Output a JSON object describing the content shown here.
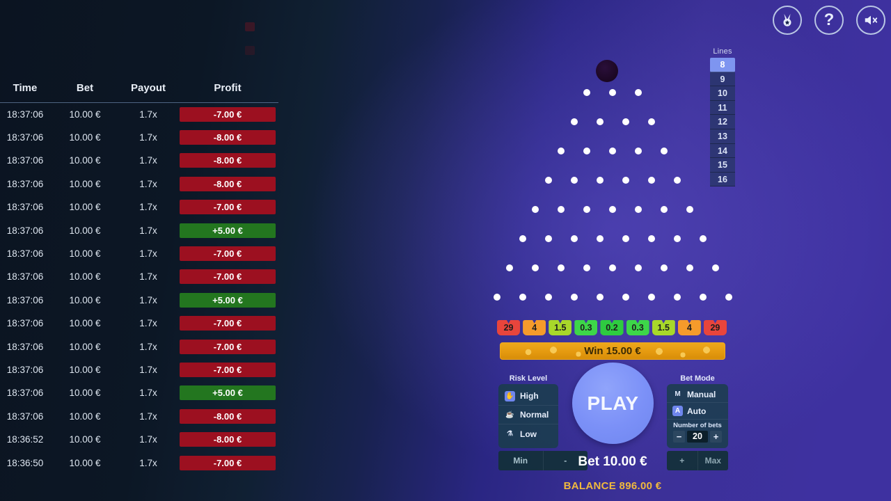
{
  "history": {
    "columns": [
      "Time",
      "Bet",
      "Payout",
      "Profit"
    ],
    "rows": [
      {
        "time": "18:37:06",
        "bet": "10.00 €",
        "payout": "1.7x",
        "profit": "-7.00 €",
        "result": "loss"
      },
      {
        "time": "18:37:06",
        "bet": "10.00 €",
        "payout": "1.7x",
        "profit": "-8.00 €",
        "result": "loss"
      },
      {
        "time": "18:37:06",
        "bet": "10.00 €",
        "payout": "1.7x",
        "profit": "-8.00 €",
        "result": "loss"
      },
      {
        "time": "18:37:06",
        "bet": "10.00 €",
        "payout": "1.7x",
        "profit": "-8.00 €",
        "result": "loss"
      },
      {
        "time": "18:37:06",
        "bet": "10.00 €",
        "payout": "1.7x",
        "profit": "-7.00 €",
        "result": "loss"
      },
      {
        "time": "18:37:06",
        "bet": "10.00 €",
        "payout": "1.7x",
        "profit": "+5.00 €",
        "result": "win"
      },
      {
        "time": "18:37:06",
        "bet": "10.00 €",
        "payout": "1.7x",
        "profit": "-7.00 €",
        "result": "loss"
      },
      {
        "time": "18:37:06",
        "bet": "10.00 €",
        "payout": "1.7x",
        "profit": "-7.00 €",
        "result": "loss"
      },
      {
        "time": "18:37:06",
        "bet": "10.00 €",
        "payout": "1.7x",
        "profit": "+5.00 €",
        "result": "win"
      },
      {
        "time": "18:37:06",
        "bet": "10.00 €",
        "payout": "1.7x",
        "profit": "-7.00 €",
        "result": "loss"
      },
      {
        "time": "18:37:06",
        "bet": "10.00 €",
        "payout": "1.7x",
        "profit": "-7.00 €",
        "result": "loss"
      },
      {
        "time": "18:37:06",
        "bet": "10.00 €",
        "payout": "1.7x",
        "profit": "-7.00 €",
        "result": "loss"
      },
      {
        "time": "18:37:06",
        "bet": "10.00 €",
        "payout": "1.7x",
        "profit": "+5.00 €",
        "result": "win"
      },
      {
        "time": "18:37:06",
        "bet": "10.00 €",
        "payout": "1.7x",
        "profit": "-8.00 €",
        "result": "loss"
      },
      {
        "time": "18:36:52",
        "bet": "10.00 €",
        "payout": "1.7x",
        "profit": "-8.00 €",
        "result": "loss"
      },
      {
        "time": "18:36:50",
        "bet": "10.00 €",
        "payout": "1.7x",
        "profit": "-7.00 €",
        "result": "loss"
      }
    ]
  },
  "topbar": {
    "icons": [
      {
        "name": "medal-icon",
        "label": ""
      },
      {
        "name": "help-icon",
        "label": "?"
      },
      {
        "name": "sound-muted-icon",
        "label": ""
      }
    ]
  },
  "lines": {
    "caption": "Lines",
    "options": [
      "8",
      "9",
      "10",
      "11",
      "12",
      "13",
      "14",
      "15",
      "16"
    ],
    "selected": "8"
  },
  "board": {
    "rows": [
      3,
      4,
      5,
      6,
      7,
      8,
      9,
      10
    ],
    "ball_present": true
  },
  "multipliers": {
    "values": [
      "29",
      "4",
      "1.5",
      "0.3",
      "0.2",
      "0.3",
      "1.5",
      "4",
      "29"
    ],
    "colors": [
      "#e8453c",
      "#f59b2b",
      "#a8d82a",
      "#3dd649",
      "#2ecc40",
      "#3dd649",
      "#a8d82a",
      "#f59b2b",
      "#e8453c"
    ]
  },
  "win_banner": {
    "text": "Win 15.00 €"
  },
  "risk": {
    "caption": "Risk Level",
    "options": [
      {
        "label": "High",
        "icon": "thumbs-up-icon",
        "glyph": "✋",
        "selected": true
      },
      {
        "label": "Normal",
        "icon": "cup-icon",
        "glyph": "☕",
        "selected": false
      },
      {
        "label": "Low",
        "icon": "bottle-icon",
        "glyph": "⚗",
        "selected": false
      }
    ],
    "min_label": "Min",
    "minus_label": "-"
  },
  "bet_mode": {
    "caption": "Bet Mode",
    "options": [
      {
        "label": "Manual",
        "badge": "M",
        "selected": false
      },
      {
        "label": "Auto",
        "badge": "A",
        "selected": true
      }
    ],
    "number_of_bets_label": "Number of bets",
    "number_of_bets": "20",
    "minus_label": "−",
    "plus_label": "+",
    "plus_row_label": "+",
    "max_label": "Max"
  },
  "play": {
    "label": "PLAY"
  },
  "bet": {
    "label": "Bet 10.00 €"
  },
  "balance": {
    "label": "BALANCE 896.00 €"
  },
  "colors": {
    "accent_blue": "#6f86ee",
    "win_green": "#23761f",
    "loss_red": "#9c1020",
    "gold": "#f0b93e",
    "background_left": "#0b1421",
    "background_right": "#3e31a0"
  }
}
